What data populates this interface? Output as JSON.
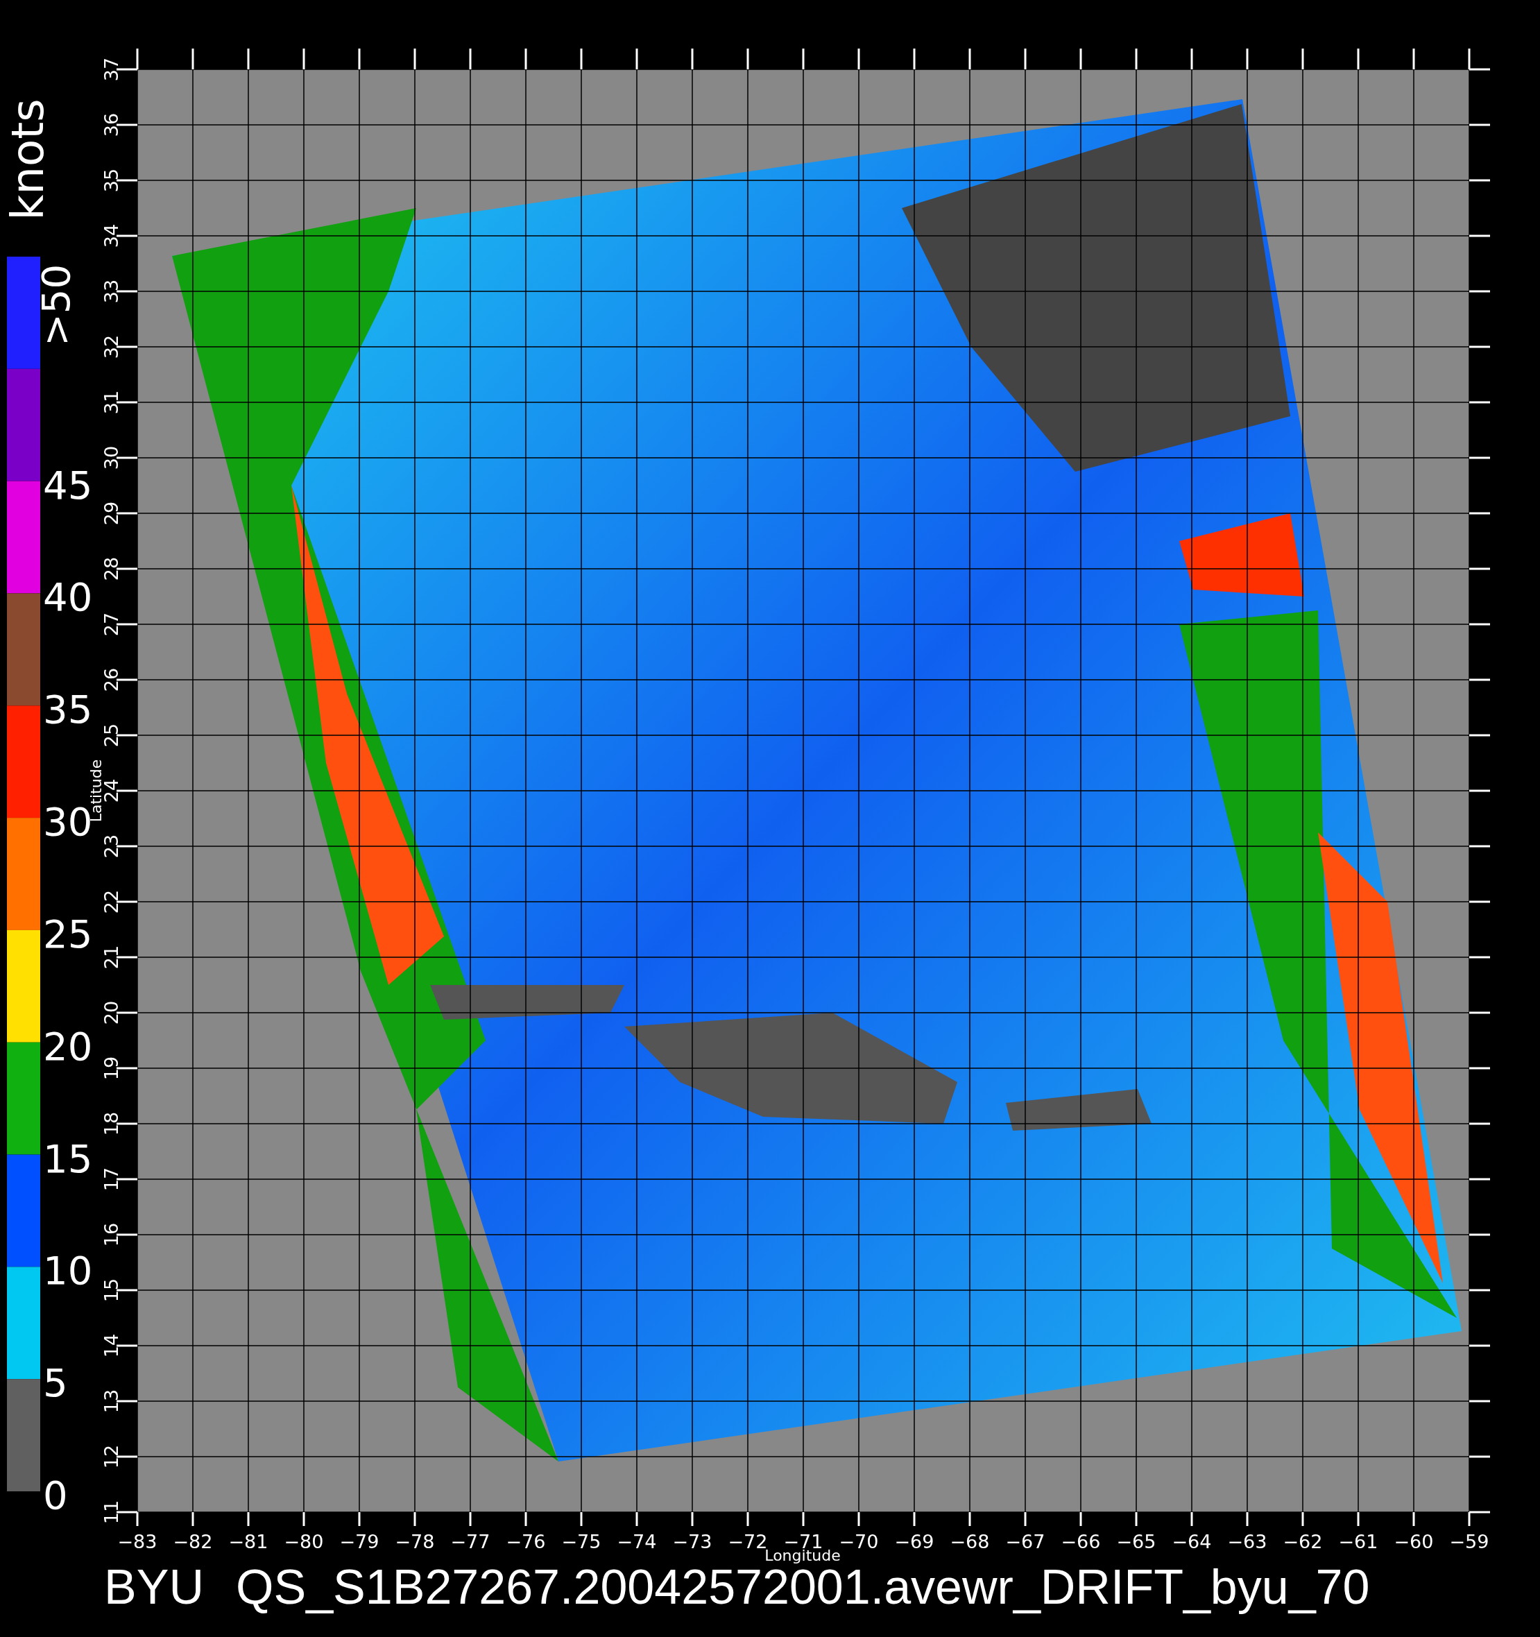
{
  "colorbar": {
    "unit": "knots",
    "segments": [
      {
        "label": ">50",
        "color": "#2020ff"
      },
      {
        "label": "45",
        "color": "#7a00c8"
      },
      {
        "label": "40",
        "color": "#e000e0"
      },
      {
        "label": "35",
        "color": "#8a4a30"
      },
      {
        "label": "30",
        "color": "#ff2000"
      },
      {
        "label": "25",
        "color": "#ff7000"
      },
      {
        "label": "20",
        "color": "#ffe000"
      },
      {
        "label": "15",
        "color": "#10b010"
      },
      {
        "label": "10",
        "color": "#0050ff"
      },
      {
        "label": "5",
        "color": "#00c8f0"
      },
      {
        "label": "0",
        "color": "#606060"
      }
    ]
  },
  "map": {
    "xlabel": "Longitude",
    "ylabel": "Latitude",
    "x_ticks": [
      "−83",
      "−82",
      "−81",
      "−80",
      "−79",
      "−78",
      "−77",
      "−76",
      "−75",
      "−74",
      "−73",
      "−72",
      "−71",
      "−70",
      "−69",
      "−68",
      "−67",
      "−66",
      "−65",
      "−64",
      "−63",
      "−62",
      "−61",
      "−60",
      "−59"
    ],
    "y_ticks": [
      "11",
      "12",
      "13",
      "14",
      "15",
      "16",
      "17",
      "18",
      "19",
      "20",
      "21",
      "22",
      "23",
      "24",
      "25",
      "26",
      "27",
      "28",
      "29",
      "30",
      "31",
      "32",
      "33",
      "34",
      "35",
      "36",
      "37"
    ]
  },
  "title": {
    "source": "BYU",
    "file": "QS_S1B27267.20042572001.avewr_DRIFT_byu_70"
  }
}
